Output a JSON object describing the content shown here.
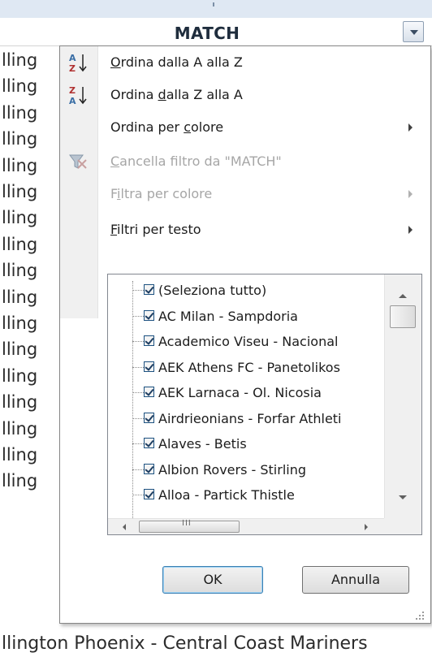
{
  "column_header": {
    "title": "MATCH"
  },
  "sheet": {
    "cell_fragment": "lling",
    "row_count": 17,
    "bottom_row_text": "llington Phoenix - Central Coast Mariners"
  },
  "menu": {
    "items": [
      {
        "id": "sort-az",
        "pre": "",
        "u": "O",
        "post": "rdina dalla A alla Z",
        "icon": "sort-ascending-icon",
        "disabled": false,
        "submenu": false
      },
      {
        "id": "sort-za",
        "pre": "Ordina ",
        "u": "d",
        "post": "alla Z alla A",
        "icon": "sort-descending-icon",
        "disabled": false,
        "submenu": false
      },
      {
        "id": "sort-color",
        "pre": "Ordina per ",
        "u": "c",
        "post": "olore",
        "icon": "",
        "disabled": false,
        "submenu": true
      },
      {
        "id": "clear-filter",
        "pre": "",
        "u": "C",
        "post": "ancella filtro da \"MATCH\"",
        "icon": "clear-filter-icon",
        "disabled": true,
        "submenu": false
      },
      {
        "id": "filter-color",
        "pre": "F",
        "u": "i",
        "post": "ltra per colore",
        "icon": "",
        "disabled": true,
        "submenu": true
      },
      {
        "id": "text-filters",
        "pre": "",
        "u": "F",
        "post": "iltri per testo",
        "icon": "",
        "disabled": false,
        "submenu": true
      }
    ]
  },
  "filter_list": {
    "items": [
      {
        "label": "(Seleziona tutto)",
        "checked": true
      },
      {
        "label": "AC Milan - Sampdoria",
        "checked": true
      },
      {
        "label": "Academico Viseu - Nacional",
        "checked": true
      },
      {
        "label": "AEK Athens FC - Panetolikos",
        "checked": true
      },
      {
        "label": "AEK Larnaca - Ol. Nicosia",
        "checked": true
      },
      {
        "label": "Airdrieonians - Forfar Athleti",
        "checked": true
      },
      {
        "label": "Alaves - Betis",
        "checked": true
      },
      {
        "label": "Albion Rovers - Stirling",
        "checked": true
      },
      {
        "label": "Alloa - Partick Thistle",
        "checked": true
      }
    ],
    "hscroll_thumb_glyph": "III"
  },
  "buttons": {
    "ok": "OK",
    "cancel": "Annulla"
  }
}
